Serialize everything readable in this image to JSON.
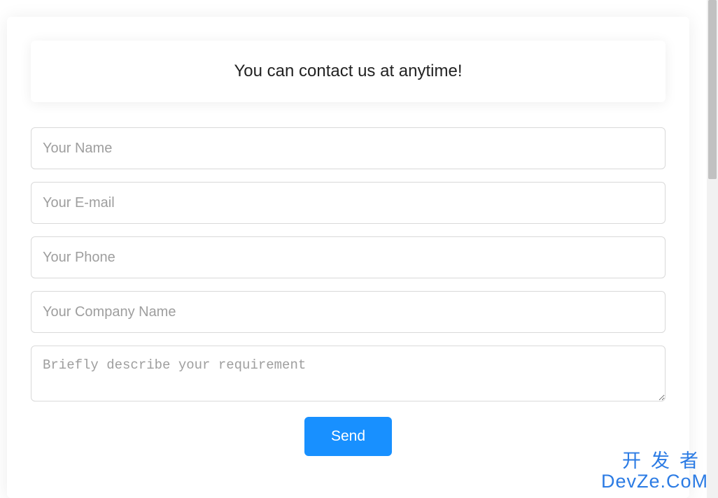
{
  "form": {
    "heading": "You can contact us at anytime!",
    "fields": {
      "name_placeholder": "Your Name",
      "email_placeholder": "Your E-mail",
      "phone_placeholder": "Your Phone",
      "company_placeholder": "Your Company Name",
      "message_placeholder": "Briefly describe your requirement"
    },
    "submit_label": "Send"
  },
  "watermark": {
    "line1": "开发者",
    "line2": "DevZe.CoM"
  }
}
